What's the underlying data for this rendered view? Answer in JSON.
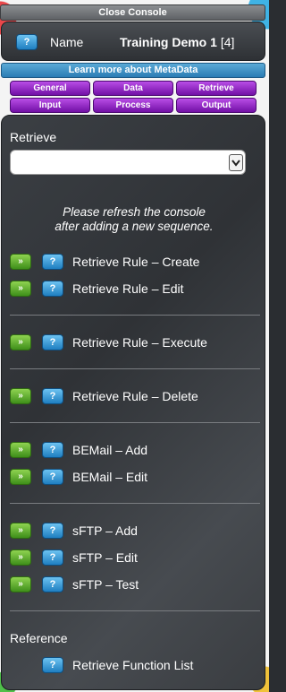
{
  "header": {
    "close_label": "Close Console",
    "name_label": "Name",
    "name_value": "Training Demo 1",
    "name_count": "[4]",
    "help_icon": "?",
    "learn_more_label": "Learn more about MetaData"
  },
  "tabs": [
    "General",
    "Data",
    "Retrieve",
    "Input",
    "Process",
    "Output"
  ],
  "retrieve": {
    "heading": "Retrieve",
    "select_value": "",
    "note_line1": "Please refresh the console",
    "note_line2": "after adding a new sequence.",
    "go_icon": "»",
    "rows": [
      "Retrieve Rule – Create",
      "Retrieve Rule – Edit",
      "Retrieve Rule – Execute",
      "Retrieve Rule – Delete",
      "BEMail – Add",
      "BEMail – Edit",
      "sFTP – Add",
      "sFTP – Edit",
      "sFTP – Test"
    ]
  },
  "reference": {
    "heading": "Reference",
    "item": "Retrieve Function List"
  },
  "colors": {
    "help_button": "#1f7fc1",
    "go_button": "#3f8f1a",
    "tab_purple": "#7210a6",
    "learn_blue": "#2b7cb4"
  }
}
